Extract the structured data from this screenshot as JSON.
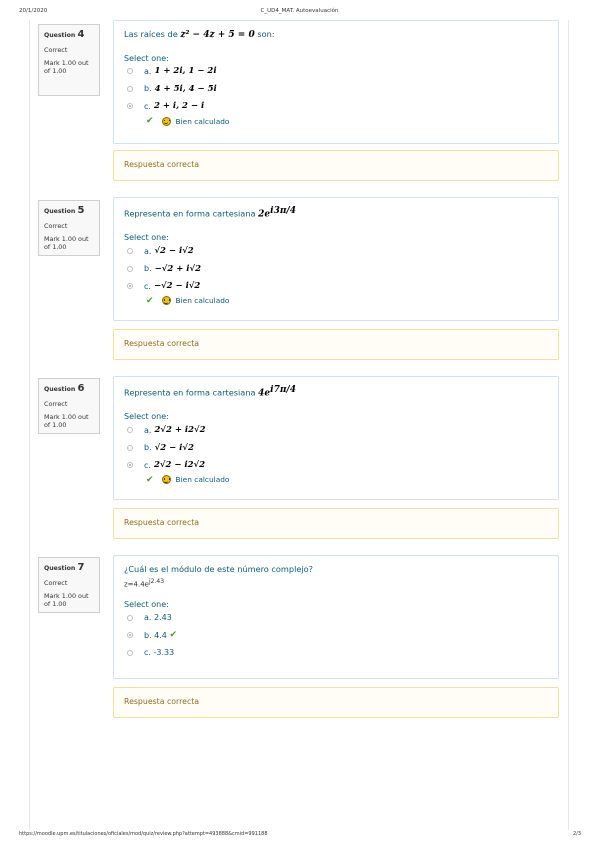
{
  "header": {
    "date": "20/1/2020",
    "title": "C_UD4_MAT. Autoevaluación"
  },
  "footer": {
    "url": "https://moodle.upm.es/titulaciones/oficiales/mod/quiz/review.php?attempt=493888&cmid=991188",
    "page": "2/3"
  },
  "questions": [
    {
      "label": "Question",
      "number": "4",
      "state": "Correct",
      "mark": "Mark 1.00 out of 1.00",
      "text": "Las raíces de",
      "math": "z² − 4z + 5 = 0",
      "text_after": "son:",
      "select_label": "Select one:",
      "options": [
        {
          "letter": "a.",
          "math": "1 + 2i,  1 − 2i",
          "selected": false
        },
        {
          "letter": "b.",
          "math": "4 + 5i,  4 − 5i",
          "selected": false
        },
        {
          "letter": "c.",
          "math": "2 + i,  2 − i",
          "selected": true
        }
      ],
      "feedback": "Bien calculado",
      "outcome": "Respuesta correcta"
    },
    {
      "label": "Question",
      "number": "5",
      "state": "Correct",
      "mark": "Mark 1.00 out of 1.00",
      "text": "Representa en forma cartesiana",
      "math": "2e",
      "math_sup": "i3π/4",
      "select_label": "Select one:",
      "options": [
        {
          "letter": "a.",
          "math": "√2 − i√2",
          "selected": false
        },
        {
          "letter": "b.",
          "math": "−√2 + i√2",
          "selected": false
        },
        {
          "letter": "c.",
          "math": "−√2 − i√2",
          "selected": true
        }
      ],
      "feedback": "Bien calculado",
      "outcome": "Respuesta correcta"
    },
    {
      "label": "Question",
      "number": "6",
      "state": "Correct",
      "mark": "Mark 1.00 out of 1.00",
      "text": "Representa en forma cartesiana",
      "math": "4e",
      "math_sup": "i7π/4",
      "select_label": "Select one:",
      "options": [
        {
          "letter": "a.",
          "math": "2√2 + i2√2",
          "selected": false
        },
        {
          "letter": "b.",
          "math": "√2 − i√2",
          "selected": false
        },
        {
          "letter": "c.",
          "math": "2√2 − i2√2",
          "selected": true
        }
      ],
      "feedback": "Bien calculado",
      "outcome": "Respuesta correcta"
    },
    {
      "label": "Question",
      "number": "7",
      "state": "Correct",
      "mark": "Mark 1.00 out of 1.00",
      "text": "¿Cuál es el módulo de este número complejo?",
      "line2": "z=4.4e",
      "line2_sup": "j2.43",
      "select_label": "Select one:",
      "options": [
        {
          "letter": "a.",
          "value": "2.43",
          "selected": false
        },
        {
          "letter": "b.",
          "value": "4.4",
          "selected": true
        },
        {
          "letter": "c.",
          "value": "-3.33",
          "selected": false
        }
      ],
      "outcome": "Respuesta correcta"
    }
  ],
  "colors": {
    "correct": "#4a9a2c",
    "link": "#0a5c7c",
    "outcome_bg": "#fffdf5",
    "outcome_border": "#f4dfa0"
  },
  "icons": [
    "check-icon",
    "smiley-icon",
    "radio-icon"
  ]
}
